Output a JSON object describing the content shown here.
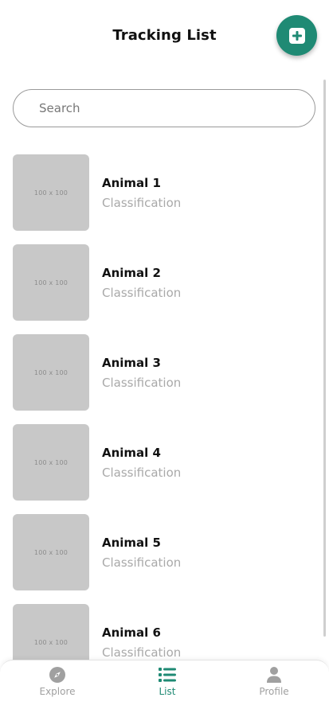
{
  "header": {
    "title": "Tracking List",
    "add_icon": "plus-square-icon"
  },
  "search": {
    "placeholder": "Search",
    "value": ""
  },
  "animals": [
    {
      "name": "Animal 1",
      "classification": "Classification",
      "thumb_text": "100 x 100"
    },
    {
      "name": "Animal 2",
      "classification": "Classification",
      "thumb_text": "100 x 100"
    },
    {
      "name": "Animal 3",
      "classification": "Classification",
      "thumb_text": "100 x 100"
    },
    {
      "name": "Animal 4",
      "classification": "Classification",
      "thumb_text": "100 x 100"
    },
    {
      "name": "Animal 5",
      "classification": "Classification",
      "thumb_text": "100 x 100"
    },
    {
      "name": "Animal 6",
      "classification": "Classification",
      "thumb_text": "100 x 100"
    }
  ],
  "nav": {
    "tabs": [
      {
        "label": "Explore",
        "icon": "compass-icon",
        "active": false
      },
      {
        "label": "List",
        "icon": "list-icon",
        "active": true
      },
      {
        "label": "Profile",
        "icon": "person-icon",
        "active": false
      }
    ]
  },
  "colors": {
    "accent": "#1f8a74",
    "thumb_placeholder": "#c8c8c8",
    "inactive": "#a0a0a0"
  }
}
